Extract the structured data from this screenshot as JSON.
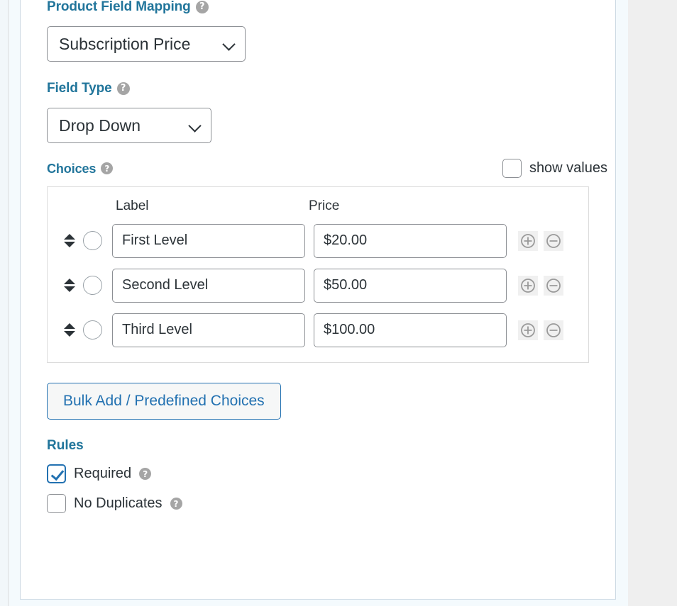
{
  "panel": {
    "product_field_mapping": {
      "label": "Product Field Mapping",
      "help": "?",
      "selected": "Subscription Price"
    },
    "field_type": {
      "label": "Field Type",
      "help": "?",
      "selected": "Drop Down"
    },
    "choices": {
      "label": "Choices",
      "help": "?",
      "show_values_label": "show values",
      "show_values_checked": false,
      "columns": {
        "label": "Label",
        "price": "Price"
      },
      "rows": [
        {
          "label": "First Level",
          "price": "$20.00",
          "selected": false
        },
        {
          "label": "Second Level",
          "price": "$50.00",
          "selected": false
        },
        {
          "label": "Third Level",
          "price": "$100.00",
          "selected": false
        }
      ],
      "add_icon": "plus-circle-icon",
      "remove_icon": "minus-circle-icon",
      "drag_icon": "drag-updown-icon"
    },
    "bulk_add": {
      "label": "Bulk Add / Predefined Choices"
    },
    "rules": {
      "title": "Rules",
      "items": [
        {
          "label": "Required",
          "checked": true,
          "help": "?"
        },
        {
          "label": "No Duplicates",
          "checked": false,
          "help": "?"
        }
      ]
    }
  },
  "colors": {
    "heading": "#21759b",
    "accent": "#2271b1",
    "text": "#2c3338",
    "help_bg": "#a5a5a5",
    "panel_bg": "#ffffff",
    "page_bg": "#f4fafd",
    "outer_bg": "#efefef"
  }
}
